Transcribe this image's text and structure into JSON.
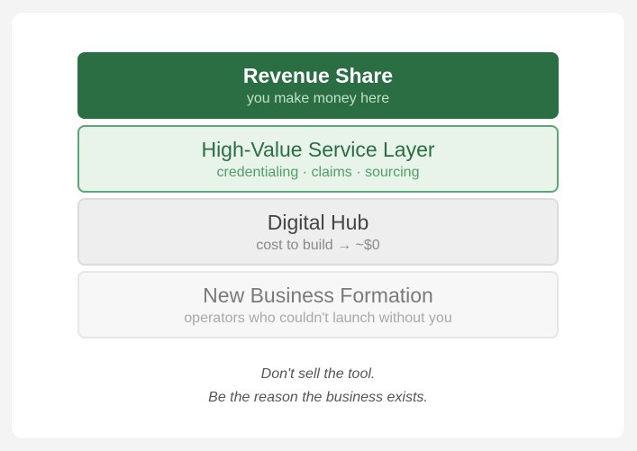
{
  "layers": [
    {
      "title": "Revenue Share",
      "subtitle": "you make money here"
    },
    {
      "title": "High-Value Service Layer",
      "subtitle": "credentialing · claims · sourcing"
    },
    {
      "title": "Digital Hub",
      "subtitle": "cost to build → ~$0"
    },
    {
      "title": "New Business Formation",
      "subtitle": "operators who couldn't launch without you"
    }
  ],
  "tagline": {
    "line1": "Don't sell the tool.",
    "line2": "Be the reason the business exists."
  },
  "colors": {
    "accent_dark_green": "#2b6e44",
    "light_green_fill": "#e8f3ea",
    "green_border": "#5aa772",
    "gray_fill": "#eeeeee",
    "light_gray_fill": "#f7f7f7"
  }
}
